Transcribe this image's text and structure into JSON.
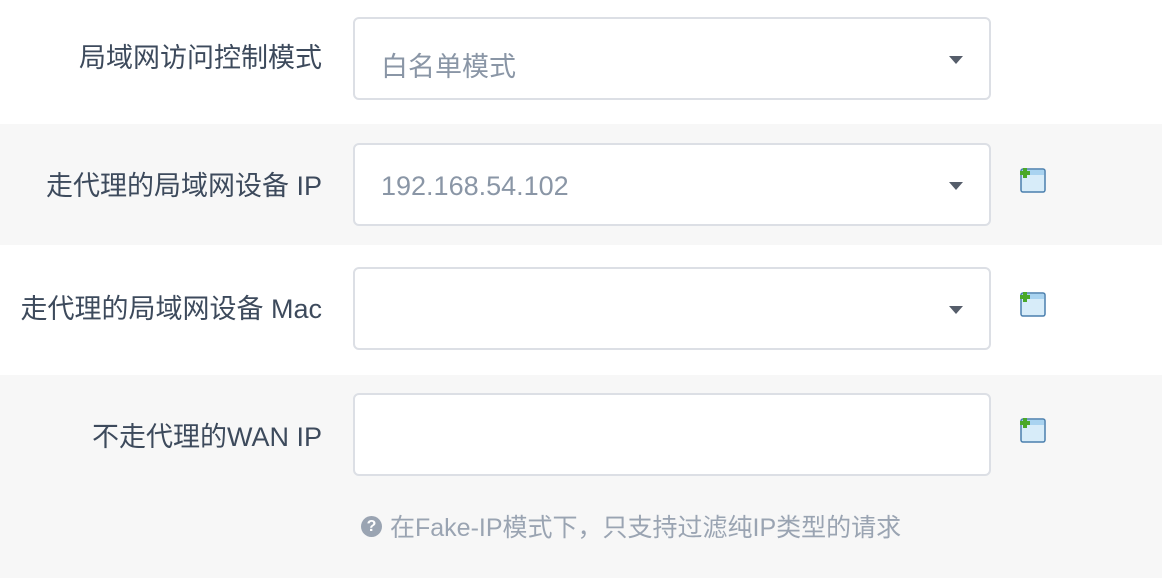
{
  "rows": [
    {
      "label": "局域网访问控制模式",
      "value": "白名单模式",
      "icon": "caret-down-icon"
    },
    {
      "label": "走代理的局域网设备 IP",
      "value": "192.168.54.102",
      "icon": "caret-down-icon",
      "action_icon": "add-entry-icon"
    },
    {
      "label": "走代理的局域网设备 Mac",
      "value": "",
      "icon": "caret-down-icon",
      "action_icon": "add-entry-icon"
    },
    {
      "label": "不走代理的WAN IP",
      "value": "",
      "action_icon": "add-entry-icon"
    }
  ],
  "hint": {
    "icon": "question-circle-icon",
    "text": "在Fake-IP模式下，只支持过滤纯IP类型的请求"
  },
  "colors": {
    "label": "#3d4a5c",
    "muted": "#8a96a6",
    "row_alt": "#f7f7f7",
    "border": "#dcdfe5"
  }
}
